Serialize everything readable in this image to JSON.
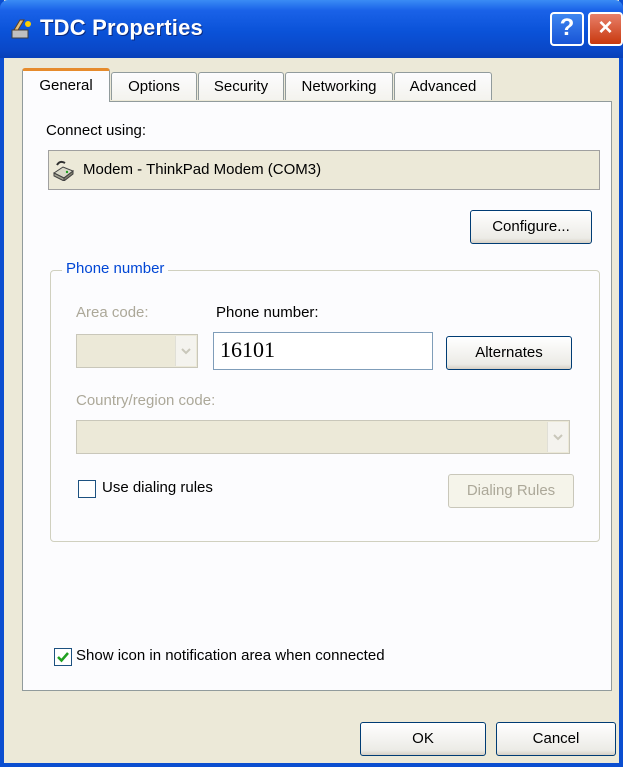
{
  "window": {
    "title": "TDC Properties",
    "help_icon": "help-icon",
    "close_icon": "close-icon",
    "help_glyph": "?",
    "close_glyph": "×"
  },
  "tabs": [
    "General",
    "Options",
    "Security",
    "Networking",
    "Advanced"
  ],
  "general": {
    "connect_using_label": "Connect using:",
    "device": {
      "icon": "modem-icon",
      "name": "Modem - ThinkPad Modem (COM3)"
    },
    "configure_button": "Configure...",
    "phone_group": {
      "legend": "Phone number",
      "area_code_label": "Area code:",
      "area_code_value": "",
      "phone_number_label": "Phone number:",
      "phone_number_value": "16101",
      "alternates_button": "Alternates",
      "country_label": "Country/region code:",
      "country_value": "",
      "use_dialing_rules_label": "Use dialing rules",
      "use_dialing_rules_checked": false,
      "dialing_rules_button": "Dialing Rules"
    },
    "show_icon_label": "Show icon in notification area when connected",
    "show_icon_checked": true
  },
  "buttons": {
    "ok": "OK",
    "cancel": "Cancel"
  },
  "colors": {
    "titlebar": "#0a52d8",
    "accent_tab": "#e68b2c",
    "group_legend": "#0046d5"
  }
}
